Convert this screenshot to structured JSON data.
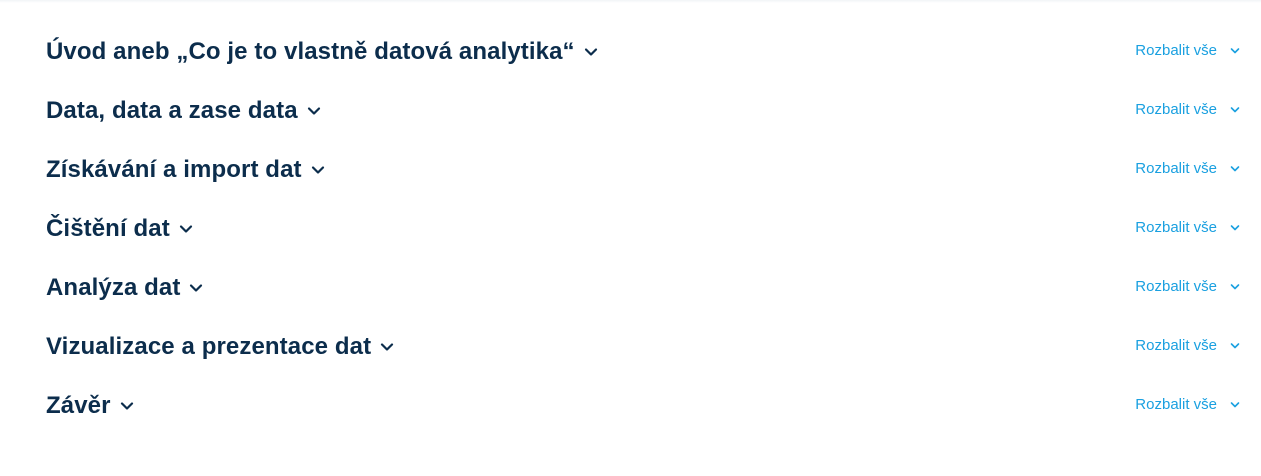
{
  "sections": [
    {
      "title": "Úvod aneb „Co je to vlastně datová analytika“",
      "expand_all_label": "Rozbalit vše"
    },
    {
      "title": "Data, data a zase data",
      "expand_all_label": "Rozbalit vše"
    },
    {
      "title": "Získávání a import dat",
      "expand_all_label": "Rozbalit vše"
    },
    {
      "title": "Čištění dat",
      "expand_all_label": "Rozbalit vše"
    },
    {
      "title": "Analýza dat",
      "expand_all_label": "Rozbalit vše"
    },
    {
      "title": "Vizualizace a prezentace dat",
      "expand_all_label": "Rozbalit vše"
    },
    {
      "title": "Závěr",
      "expand_all_label": "Rozbalit vše"
    }
  ],
  "icons": {
    "section_toggle": "chevron-down-icon",
    "expand_all": "chevron-down-icon"
  },
  "colors": {
    "title": "#0c2d4c",
    "link": "#1aa0e0",
    "background": "#ffffff"
  }
}
